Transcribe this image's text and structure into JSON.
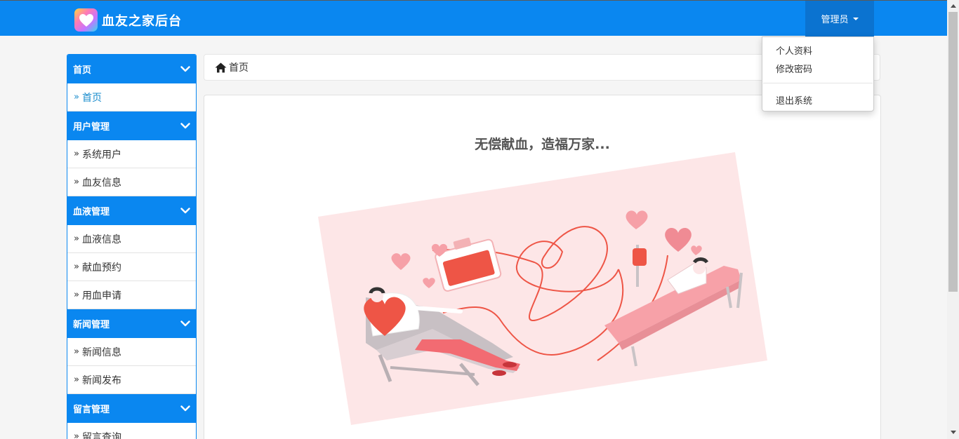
{
  "header": {
    "title": "血友之家后台",
    "user_menu_label": "管理员",
    "brand_color": "#0a87f0"
  },
  "user_dropdown": {
    "items": [
      "个人资料",
      "修改密码",
      "退出系统"
    ]
  },
  "sidebar": {
    "groups": [
      {
        "label": "首页",
        "items": [
          "首页"
        ]
      },
      {
        "label": "用户管理",
        "items": [
          "系统用户",
          "血友信息"
        ]
      },
      {
        "label": "血液管理",
        "items": [
          "血液信息",
          "献血预约",
          "用血申请"
        ]
      },
      {
        "label": "新闻管理",
        "items": [
          "新闻信息",
          "新闻发布"
        ]
      },
      {
        "label": "留言管理",
        "items": [
          "留言查询"
        ]
      }
    ],
    "active_item": "首页",
    "item_prefix": "»"
  },
  "breadcrumb": {
    "label": "首页",
    "icon": "home-icon"
  },
  "main": {
    "slogan": "无偿献血，造福万家..."
  }
}
